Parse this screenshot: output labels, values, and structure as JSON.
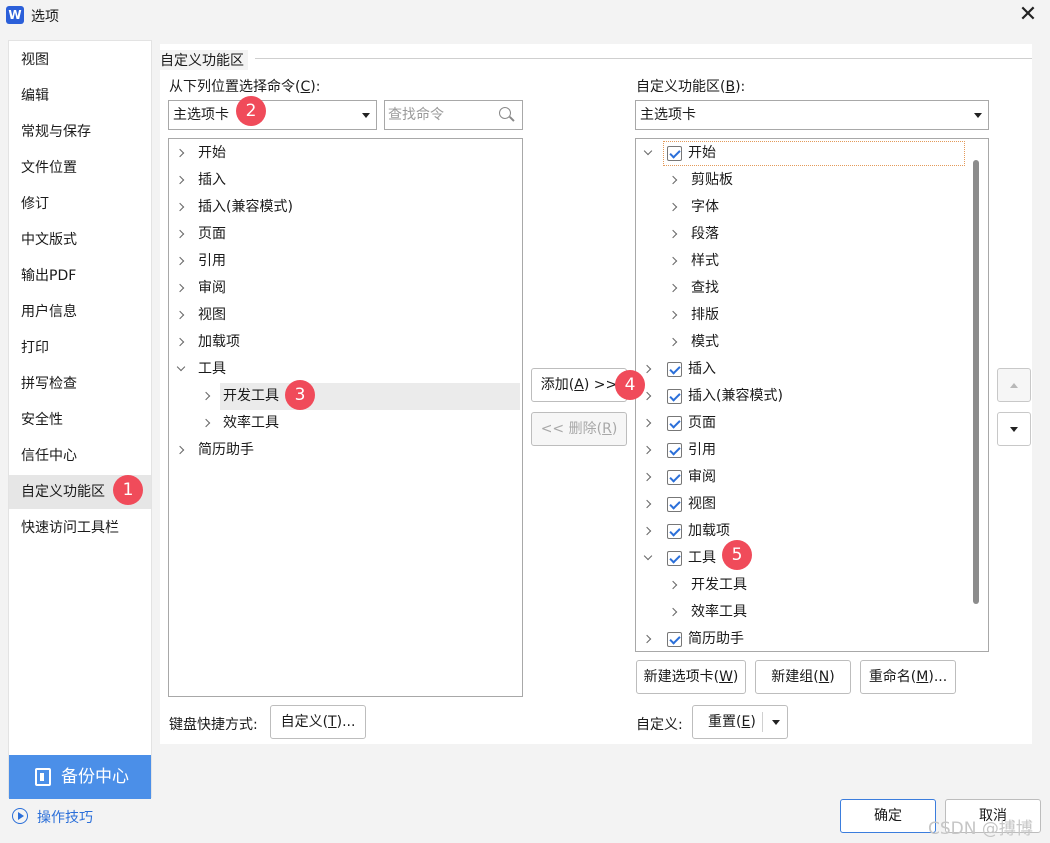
{
  "window": {
    "icon": "W",
    "title": "选项",
    "close": "✕"
  },
  "sidebar": {
    "items": [
      "视图",
      "编辑",
      "常规与保存",
      "文件位置",
      "修订",
      "中文版式",
      "输出PDF",
      "用户信息",
      "打印",
      "拼写检查",
      "安全性",
      "信任中心",
      "自定义功能区",
      "快速访问工具栏"
    ],
    "active": "自定义功能区",
    "backup_label": "备份中心",
    "tips_label": "操作技巧"
  },
  "section_title": "自定义功能区",
  "left": {
    "label_prefix": "从下列位置选择命令(",
    "label_key": "C",
    "label_suffix": "):",
    "combo_value": "主选项卡",
    "search_placeholder": "查找命令",
    "tree": [
      "开始",
      "插入",
      "插入(兼容模式)",
      "页面",
      "引用",
      "审阅",
      "视图",
      "加载项",
      "工具",
      "开发工具",
      "效率工具",
      "简历助手"
    ],
    "selected": "开发工具"
  },
  "middle": {
    "add_prefix": "添加(",
    "add_key": "A",
    "add_suffix": ") >>",
    "remove_prefix": "<< 删除(",
    "remove_key": "R",
    "remove_suffix": ")"
  },
  "right": {
    "label_prefix": "自定义功能区(",
    "label_key": "B",
    "label_suffix": "):",
    "combo_value": "主选项卡",
    "tree": [
      "开始",
      "剪贴板",
      "字体",
      "段落",
      "样式",
      "查找",
      "排版",
      "模式",
      "插入",
      "插入(兼容模式)",
      "页面",
      "引用",
      "审阅",
      "视图",
      "加载项",
      "工具",
      "开发工具",
      "效率工具",
      "简历助手"
    ],
    "checked": true
  },
  "buttons": {
    "new_tab": {
      "prefix": "新建选项卡(",
      "key": "W",
      "suffix": ")"
    },
    "new_group": {
      "prefix": "新建组(",
      "key": "N",
      "suffix": ")"
    },
    "rename": {
      "prefix": "重命名(",
      "key": "M",
      "suffix": ")..."
    },
    "custom": {
      "prefix": "自定义(",
      "key": "T",
      "suffix": ")..."
    },
    "reset": {
      "prefix": "重置(",
      "key": "E",
      "suffix": ")"
    },
    "ok": "确定",
    "cancel": "取消"
  },
  "labels": {
    "keyboard": "键盘快捷方式:",
    "customize": "自定义:"
  },
  "badges": [
    "1",
    "2",
    "3",
    "4",
    "5"
  ],
  "watermark": "CSDN @搏博",
  "colors": {
    "accent": "#4b8fe8",
    "badge": "#f04b5a",
    "check": "#2b6fd9"
  }
}
